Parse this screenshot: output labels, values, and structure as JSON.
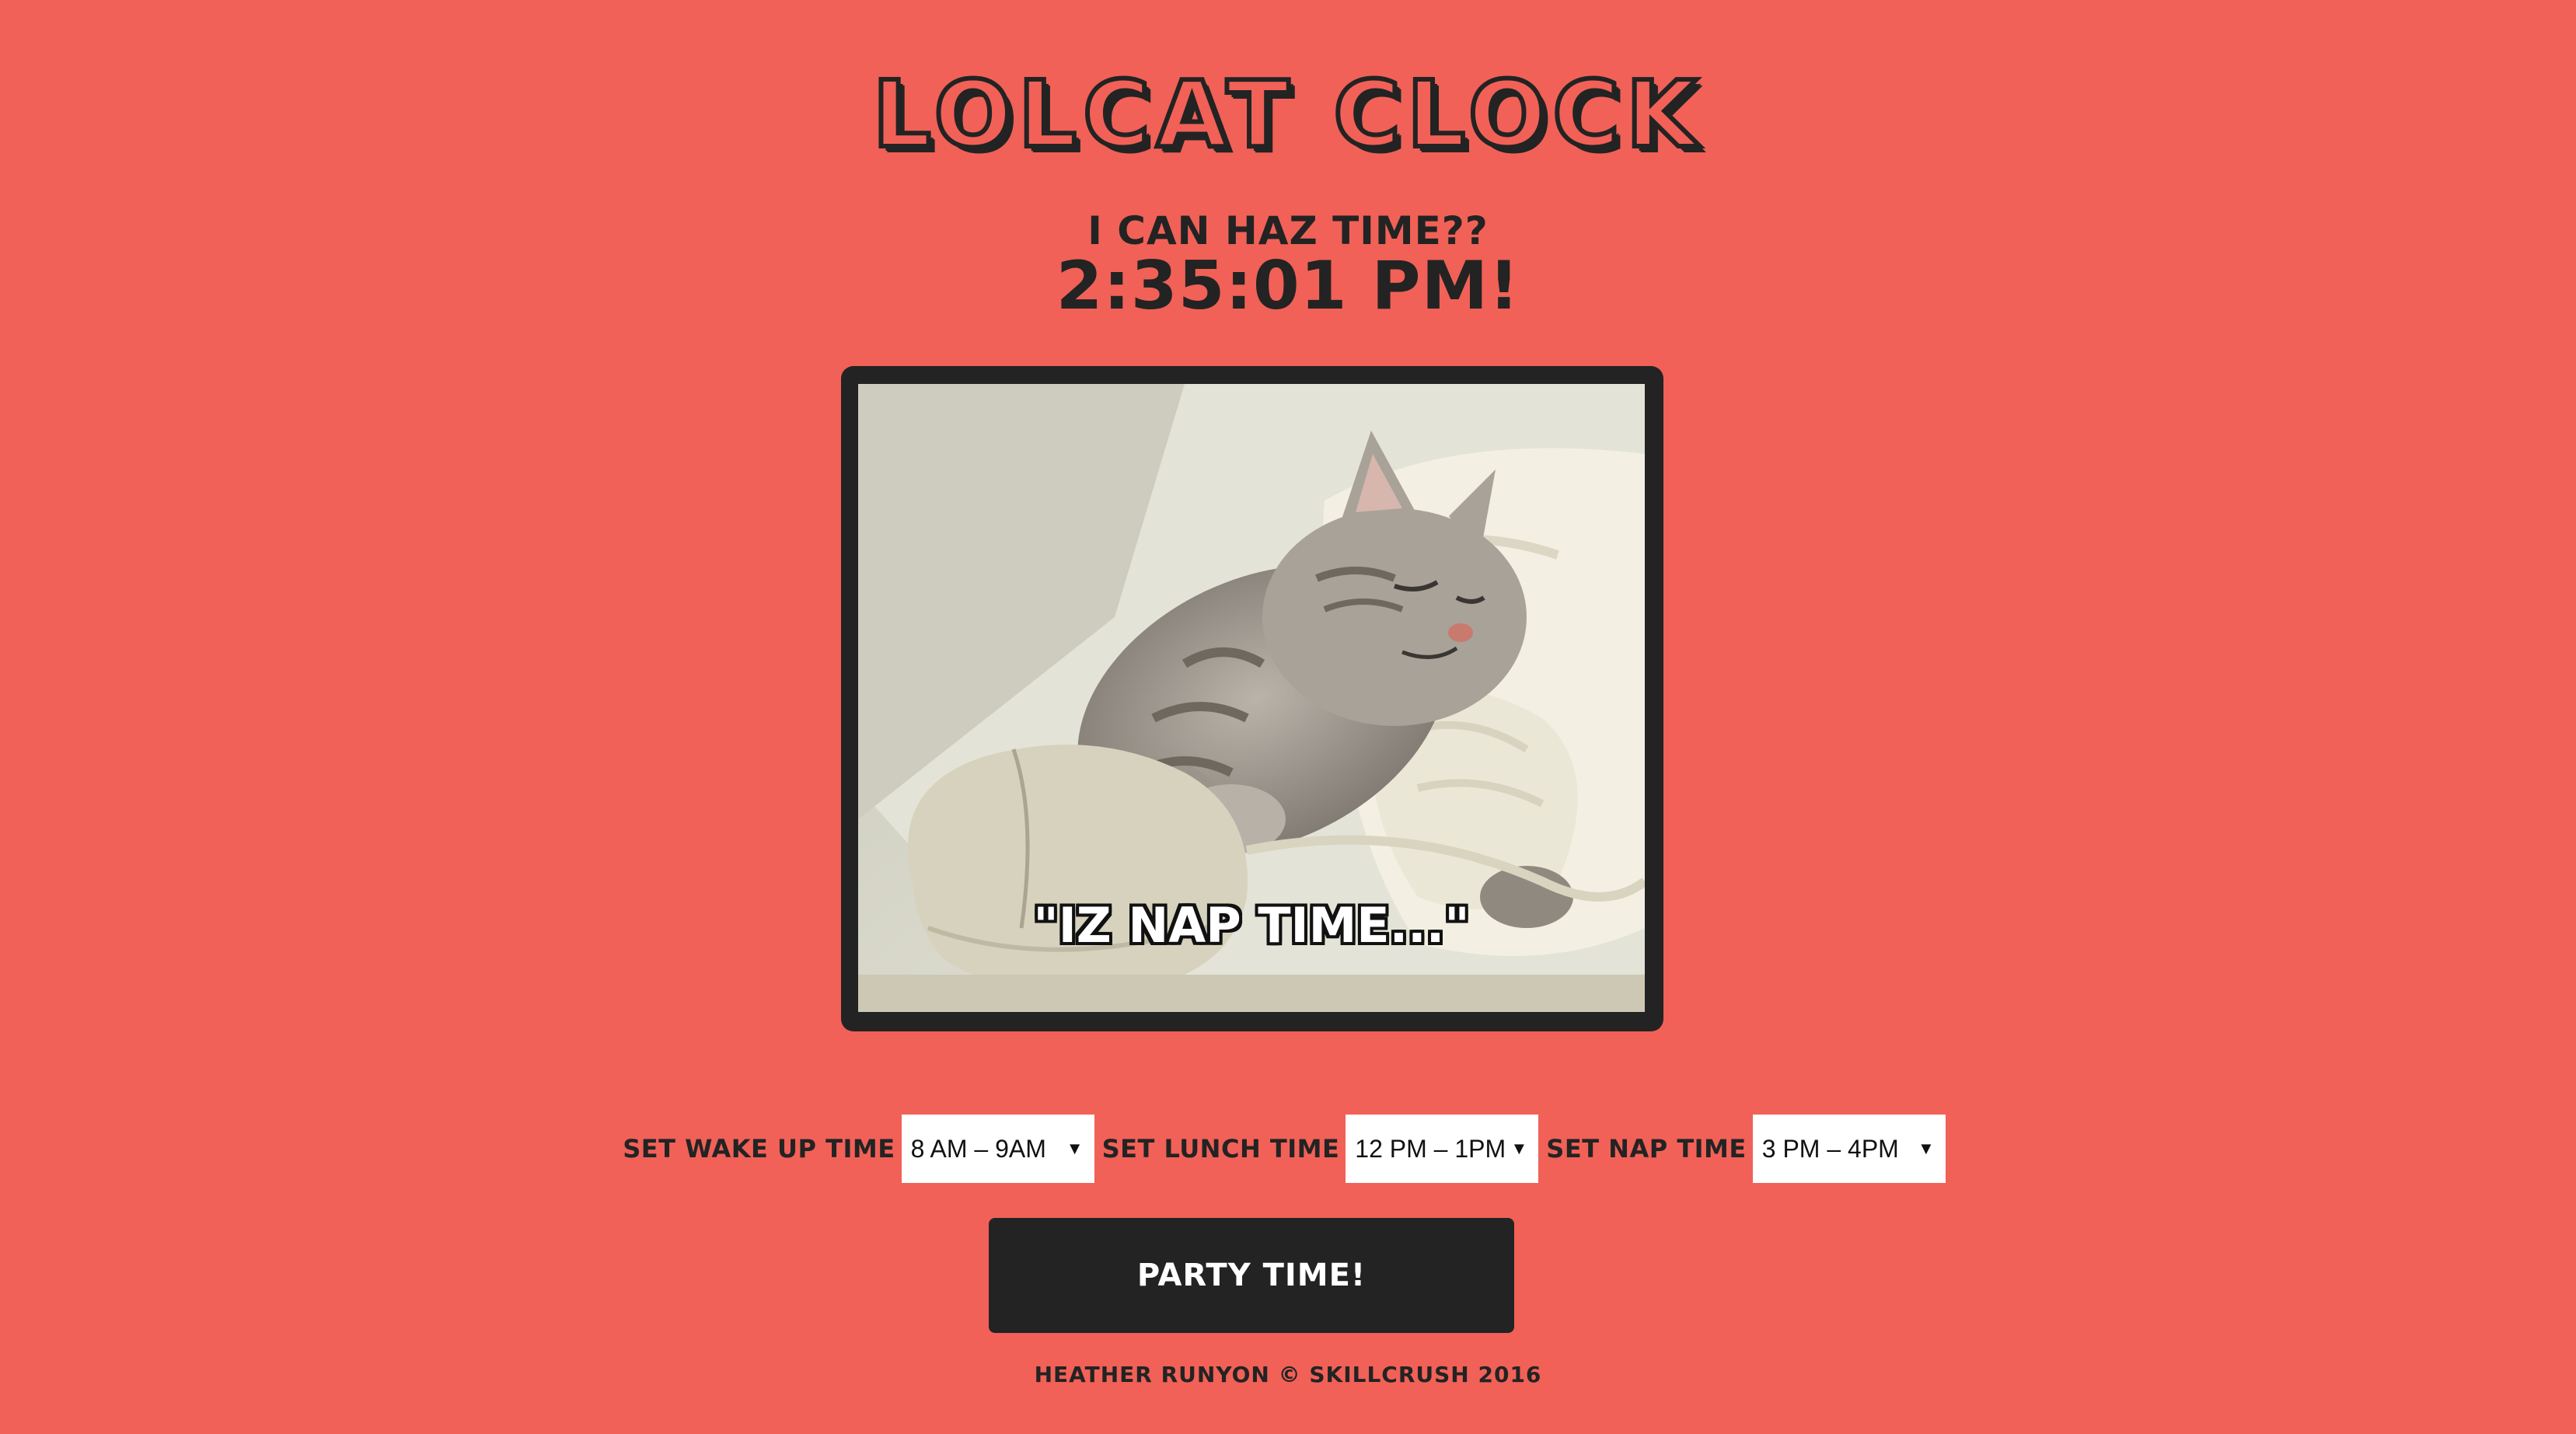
{
  "header": {
    "title": "LOLCAT CLOCK",
    "subtitle": "I CAN HAZ TIME??",
    "time": "2:35:01 PM!"
  },
  "image": {
    "caption": "\"IZ NAP TIME...\""
  },
  "controls": {
    "wake": {
      "label": "SET WAKE UP TIME",
      "value": "8 AM – 9AM"
    },
    "lunch": {
      "label": "SET LUNCH TIME",
      "value": "12 PM – 1PM"
    },
    "nap": {
      "label": "SET NAP TIME",
      "value": "3 PM – 4PM"
    },
    "dropdown_icon": "caret-down-icon"
  },
  "party_button": {
    "label": "PARTY TIME!"
  },
  "footer": {
    "text": "HEATHER RUNYON © SKILLCRUSH 2016"
  },
  "colors": {
    "background": "#f16157",
    "dark": "#232323",
    "white": "#ffffff"
  }
}
